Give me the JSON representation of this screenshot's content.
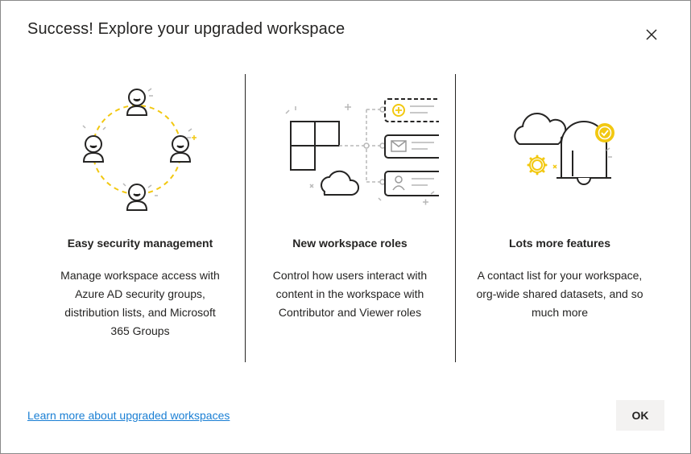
{
  "dialog": {
    "title": "Success! Explore your upgraded workspace",
    "close_icon": "close-icon"
  },
  "features": [
    {
      "icon": "security-groups-illustration",
      "title": "Easy security management",
      "description": "Manage workspace access with Azure AD security groups, distribution lists, and Microsoft 365 Groups"
    },
    {
      "icon": "workspace-roles-illustration",
      "title": "New workspace roles",
      "description": "Control how users interact with content in the workspace with Contributor and Viewer roles"
    },
    {
      "icon": "more-features-illustration",
      "title": "Lots more features",
      "description": "A contact list for your workspace, org-wide shared datasets, and so much more"
    }
  ],
  "footer": {
    "learn_more_link": "Learn more about upgraded workspaces",
    "ok_label": "OK"
  },
  "colors": {
    "accent_yellow": "#F2C811",
    "link_blue": "#1A7FD4",
    "text_dark": "#252423",
    "button_bg": "#F3F2F1"
  }
}
